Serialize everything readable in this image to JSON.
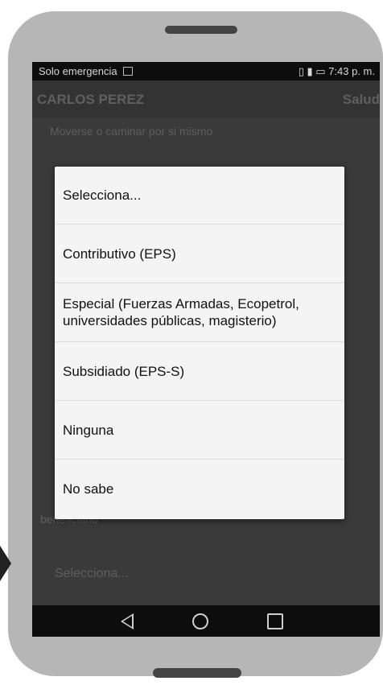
{
  "status_bar": {
    "carrier": "Solo emergencia",
    "time": "7:43 p. m."
  },
  "app_bar": {
    "title": "CARLOS PEREZ",
    "right_label": "Salud"
  },
  "background_form": {
    "question_label": "Moverse o caminar por si mismo",
    "footer_label": "beneficiario",
    "select_placeholder": "Selecciona..."
  },
  "dialog": {
    "options": [
      {
        "line1": "Selecciona..."
      },
      {
        "line1": "Contributivo (EPS)"
      },
      {
        "line1": "Especial (Fuerzas Armadas, Ecopetrol,",
        "line2": "universidades públicas, magisterio)"
      },
      {
        "line1": "Subsidiado (EPS-S)"
      },
      {
        "line1": "Ninguna"
      },
      {
        "line1": "No sabe"
      }
    ]
  }
}
